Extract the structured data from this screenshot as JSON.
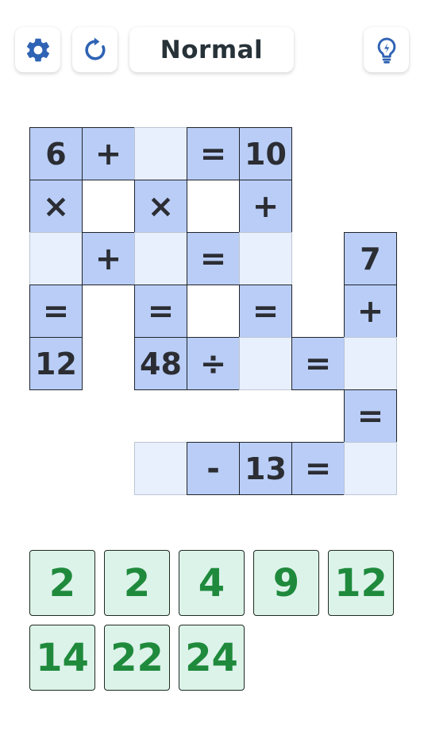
{
  "header": {
    "settings_icon": "gear-icon",
    "reset_icon": "refresh-icon",
    "hint_icon": "lightbulb-icon",
    "mode_label": "Normal",
    "accent_color": "#2f63b4"
  },
  "board": {
    "colors": {
      "given": "#b9cdf6",
      "empty": "#e8f0fe",
      "tile": "#dcf3ea",
      "tile_text": "#1f8a3c"
    },
    "cells": [
      {
        "row": 0,
        "col": 0,
        "type": "given",
        "value": "6"
      },
      {
        "row": 0,
        "col": 1,
        "type": "given",
        "value": "+"
      },
      {
        "row": 0,
        "col": 2,
        "type": "empty",
        "value": ""
      },
      {
        "row": 0,
        "col": 3,
        "type": "given",
        "value": "="
      },
      {
        "row": 0,
        "col": 4,
        "type": "given",
        "value": "10"
      },
      {
        "row": 1,
        "col": 0,
        "type": "given",
        "value": "×"
      },
      {
        "row": 1,
        "col": 2,
        "type": "given",
        "value": "×"
      },
      {
        "row": 1,
        "col": 4,
        "type": "given",
        "value": "+"
      },
      {
        "row": 2,
        "col": 0,
        "type": "empty",
        "value": ""
      },
      {
        "row": 2,
        "col": 1,
        "type": "given",
        "value": "+"
      },
      {
        "row": 2,
        "col": 2,
        "type": "empty",
        "value": ""
      },
      {
        "row": 2,
        "col": 3,
        "type": "given",
        "value": "="
      },
      {
        "row": 2,
        "col": 4,
        "type": "empty",
        "value": ""
      },
      {
        "row": 2,
        "col": 6,
        "type": "given",
        "value": "7"
      },
      {
        "row": 3,
        "col": 0,
        "type": "given",
        "value": "="
      },
      {
        "row": 3,
        "col": 2,
        "type": "given",
        "value": "="
      },
      {
        "row": 3,
        "col": 4,
        "type": "given",
        "value": "="
      },
      {
        "row": 3,
        "col": 6,
        "type": "given",
        "value": "+"
      },
      {
        "row": 4,
        "col": 0,
        "type": "given",
        "value": "12"
      },
      {
        "row": 4,
        "col": 2,
        "type": "given",
        "value": "48"
      },
      {
        "row": 4,
        "col": 3,
        "type": "given",
        "value": "÷"
      },
      {
        "row": 4,
        "col": 4,
        "type": "empty",
        "value": ""
      },
      {
        "row": 4,
        "col": 5,
        "type": "given",
        "value": "="
      },
      {
        "row": 4,
        "col": 6,
        "type": "empty",
        "value": ""
      },
      {
        "row": 5,
        "col": 6,
        "type": "given",
        "value": "="
      },
      {
        "row": 6,
        "col": 2,
        "type": "empty",
        "value": ""
      },
      {
        "row": 6,
        "col": 3,
        "type": "given",
        "value": "-"
      },
      {
        "row": 6,
        "col": 4,
        "type": "given",
        "value": "13"
      },
      {
        "row": 6,
        "col": 5,
        "type": "given",
        "value": "="
      },
      {
        "row": 6,
        "col": 6,
        "type": "empty",
        "value": ""
      }
    ]
  },
  "tiles": [
    "2",
    "2",
    "4",
    "9",
    "12",
    "14",
    "22",
    "24"
  ]
}
